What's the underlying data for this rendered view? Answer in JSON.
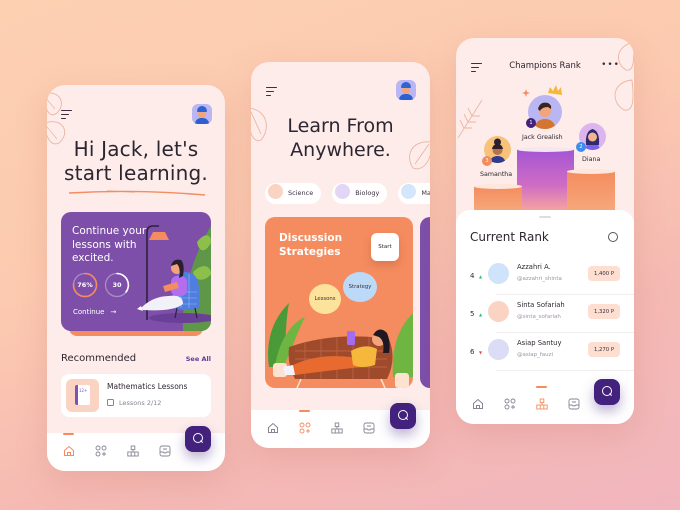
{
  "screens": {
    "home": {
      "greeting": "Hi Jack, let's start learning.",
      "greeting_line1": "Hi Jack, let's",
      "greeting_line2": "start learning.",
      "continue_card": {
        "text": "Continue your lessons with excited.",
        "progress_percent_label": "76%",
        "progress_percent": 76,
        "lessons_count": "30",
        "continue_label": "Continue",
        "arrow": "→",
        "color": "#7d4fa8"
      },
      "recommended": {
        "title": "Recommended",
        "see_all": "See All",
        "items": [
          {
            "name": "Mathematics Lessons",
            "sub": "Lessons 2/12",
            "thumb_label": "12+"
          }
        ]
      },
      "active_nav": "home"
    },
    "explore": {
      "title_line1": "Learn From",
      "title_line2": "Anywhere.",
      "categories": [
        {
          "label": "Science",
          "icon": "atom-icon",
          "color": "#fbd3c3"
        },
        {
          "label": "Biology",
          "icon": "brain-icon",
          "color": "#e2d5f5"
        },
        {
          "label": "Math",
          "icon": "calculator-icon",
          "color": "#d4e6fb"
        }
      ],
      "course_card": {
        "title_line1": "Discussion",
        "title_line2": "Strategies",
        "start_label": "Start",
        "bubbles": [
          "Lessons",
          "Strategy"
        ],
        "color": "#f48c5f"
      },
      "active_nav": "categories"
    },
    "rank": {
      "title": "Champions Rank",
      "more": "•••",
      "podium": [
        {
          "rank": "1",
          "name": "Jack Grealish"
        },
        {
          "rank": "2",
          "name": "Diana"
        },
        {
          "rank": "3",
          "name": "Samantha"
        }
      ],
      "current_rank_title": "Current Rank",
      "rows": [
        {
          "rank": "4",
          "trend": "up",
          "trend_glyph": "▲",
          "name": "Azzahri A.",
          "handle": "@azzahri_shinta",
          "points": "1,400 P"
        },
        {
          "rank": "5",
          "trend": "up",
          "trend_glyph": "▲",
          "name": "Sinta Sofariah",
          "handle": "@sinta_sofariah",
          "points": "1,320 P"
        },
        {
          "rank": "6",
          "trend": "down",
          "trend_glyph": "▼",
          "name": "Asiap Santuy",
          "handle": "@asiap_fauzi",
          "points": "1,270 P"
        }
      ],
      "active_nav": "leaderboard"
    }
  },
  "nav_items": [
    {
      "id": "home",
      "icon": "home-icon"
    },
    {
      "id": "categories",
      "icon": "grid-plus-icon"
    },
    {
      "id": "leaderboard",
      "icon": "leaderboard-icon"
    },
    {
      "id": "inbox",
      "icon": "inbox-icon"
    }
  ],
  "colors": {
    "accent_orange": "#f48c5f",
    "primary_purple": "#42227c",
    "card_purple": "#7d4fa8",
    "trend_up": "#2cb67d",
    "trend_down": "#e5484d"
  }
}
